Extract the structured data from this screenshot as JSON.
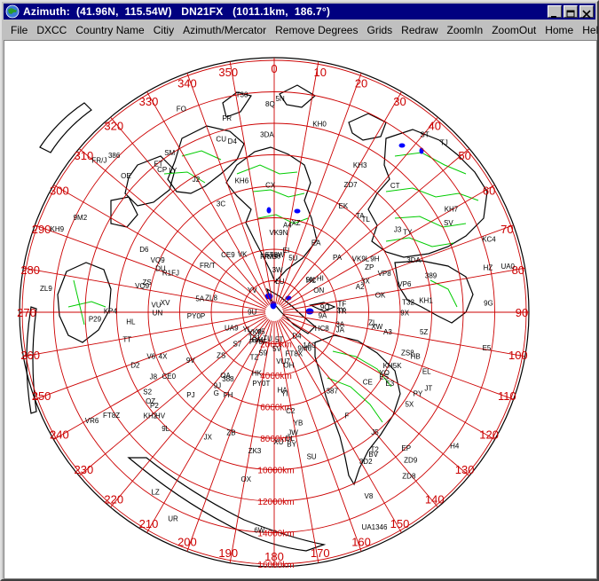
{
  "window": {
    "title": "Azimuth:  (41.96N,  115.54W)   DN21FX   (1011.1km,  186.7°)",
    "controls": [
      "minimize",
      "maximize",
      "close"
    ]
  },
  "menu": [
    "File",
    "DXCC",
    "Country Name",
    "Citiy",
    "Azimuth/Mercator",
    "Remove Degrees",
    "Grids",
    "Redraw",
    "ZoomIn",
    "ZoomOut",
    "Home",
    "Help"
  ],
  "map": {
    "type": "azimuthal-equidistant",
    "center_label": "DN21FX",
    "azimuth_labels": [
      "0",
      "10",
      "20",
      "30",
      "40",
      "50",
      "60",
      "70",
      "80",
      "90",
      "100",
      "110",
      "120",
      "130",
      "140",
      "150",
      "160",
      "170",
      "180",
      "190",
      "200",
      "210",
      "220",
      "230",
      "240",
      "250",
      "260",
      "270",
      "280",
      "290",
      "300",
      "310",
      "320",
      "330",
      "340",
      "350"
    ],
    "distance_labels": [
      "2000km",
      "4000km",
      "6000km",
      "8000km",
      "10000km",
      "12000km",
      "14000km",
      "16000km"
    ],
    "colors": {
      "grid": "#cc0000",
      "land": "#000000",
      "borders": "#00cc00",
      "lakes": "#0000ff",
      "background": "#ffffff"
    },
    "prefixes": [
      "VQ9",
      "VU7",
      "VU",
      "9N",
      "S2",
      "XZ",
      "JT",
      "BY",
      "BV",
      "HL",
      "JA",
      "UA0",
      "UA9",
      "UA1346",
      "R1FJ",
      "OX",
      "TF",
      "JW",
      "JX",
      "EI",
      "G",
      "ON",
      "PA",
      "DL",
      "OZ",
      "SM",
      "OH",
      "ES",
      "YL",
      "LY",
      "UR",
      "UN",
      "EK",
      "4X",
      "YI",
      "EP",
      "A4",
      "HZ",
      "ST",
      "ET",
      "5Z",
      "9J",
      "ZS",
      "3DA",
      "A2",
      "V5",
      "D2",
      "9Q",
      "TL",
      "TT",
      "5U",
      "6W",
      "D4",
      "CU",
      "CT",
      "EA",
      "3A",
      "9A",
      "ZD7",
      "ZD8",
      "ZS8",
      "PY0P",
      "PY0F",
      "PY0T",
      "ZD9",
      "3Y",
      "PY",
      "CE",
      "CE0",
      "LU",
      "CX",
      "ZP",
      "CP",
      "OA",
      "HC",
      "HC8",
      "HK",
      "YV",
      "PJ",
      "J3",
      "J8",
      "HI",
      "KP4",
      "FO",
      "VP6",
      "VR6",
      "KH6",
      "KH7",
      "KH1",
      "KH3",
      "KH5K",
      "KH9",
      "KH2",
      "KH0",
      "V6",
      "T30",
      "T31",
      "T32",
      "T2",
      "3D2",
      "ZL8",
      "ZL",
      "ZL9",
      "VK9",
      "VK",
      "VK9N",
      "VK9L",
      "P2",
      "V8",
      "9V",
      "9M2",
      "9M6",
      "XU",
      "XV",
      "XW",
      "3W",
      "DU",
      "H4",
      "YB",
      "A3",
      "KH8",
      "E5",
      "ZK3",
      "C2",
      "P29",
      "CE9",
      "KC4",
      "VP8",
      "FT8Z",
      "FT8X",
      "FT8W",
      "389",
      "388",
      "387",
      "386",
      "FR",
      "FR/T",
      "FR/G",
      "FR/J",
      "FH",
      "D6",
      "S7",
      "8Q",
      "VQ9",
      "HV",
      "1A0",
      "9H",
      "SV",
      "TA",
      "YO",
      "LZ",
      "HA",
      "OM",
      "OK",
      "OE",
      "HB",
      "F",
      "ZB",
      "5A",
      "SU",
      "J2",
      "E3",
      "9U",
      "9X",
      "5X",
      "S9",
      "3C",
      "TJ",
      "TR",
      "9G",
      "5N",
      "TY",
      "TU",
      "EL",
      "9L",
      "3X",
      "J5",
      "D4",
      "5T",
      "TZ",
      "5V",
      "ZS",
      "3DA"
    ]
  }
}
